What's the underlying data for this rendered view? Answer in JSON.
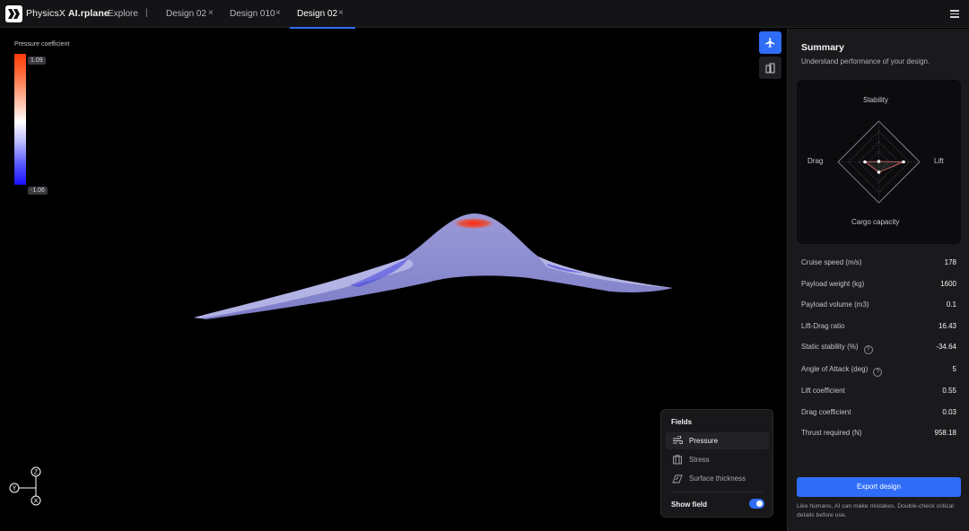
{
  "app": {
    "title_lead": "PhysicsX ",
    "title_bold": "AI.rplane"
  },
  "tabs": [
    {
      "label": "Explore",
      "closable": false
    },
    {
      "label": "Design 02",
      "closable": true
    },
    {
      "label": "Design 010",
      "closable": true
    },
    {
      "label": "Design 02",
      "closable": true,
      "active": true
    }
  ],
  "separator": "|",
  "close_glyph": "×",
  "legend": {
    "title": "Pressure coefficient",
    "max": "1.09",
    "min": "-1.06"
  },
  "axes": {
    "z": "Z",
    "y": "Y",
    "x": "X"
  },
  "fields": {
    "title": "Fields",
    "items": [
      {
        "label": "Pressure",
        "icon": "wind-icon",
        "selected": true
      },
      {
        "label": "Stress",
        "icon": "stress-icon",
        "selected": false
      },
      {
        "label": "Surface thickness",
        "icon": "surface-icon",
        "selected": false
      }
    ],
    "show_field_label": "Show field",
    "show_field_on": true
  },
  "summary": {
    "title": "Summary",
    "subtitle": "Understand performance of your design.",
    "radar": {
      "top": "Stability",
      "left": "Drag",
      "right": "Lift",
      "bottom": "Cargo capacity"
    },
    "metrics": [
      {
        "name": "Cruise speed (m/s)",
        "value": "178",
        "info": false
      },
      {
        "name": "Payload weight (kg)",
        "value": "1600",
        "info": false
      },
      {
        "name": "Payload volume (m3)",
        "value": "0.1",
        "info": false
      },
      {
        "name": "Lift-Drag ratio",
        "value": "16.43",
        "info": false
      },
      {
        "name": "Static stability (%)",
        "value": "-34.64",
        "info": true
      },
      {
        "name": "Angle of Attack (deg)",
        "value": "5",
        "info": true
      },
      {
        "name": "Lift coefficient",
        "value": "0.55",
        "info": false
      },
      {
        "name": "Drag coefficient",
        "value": "0.03",
        "info": false
      },
      {
        "name": "Thrust required (N)",
        "value": "958.18",
        "info": false
      }
    ],
    "info_glyph": "?",
    "export_label": "Export design",
    "disclaimer": "Like humans, AI can make mistakes. Double-check critical details before use."
  },
  "colors": {
    "accent": "#2f6df6",
    "pressure_high": "#ff3b0a",
    "pressure_low": "#1a10ff"
  }
}
